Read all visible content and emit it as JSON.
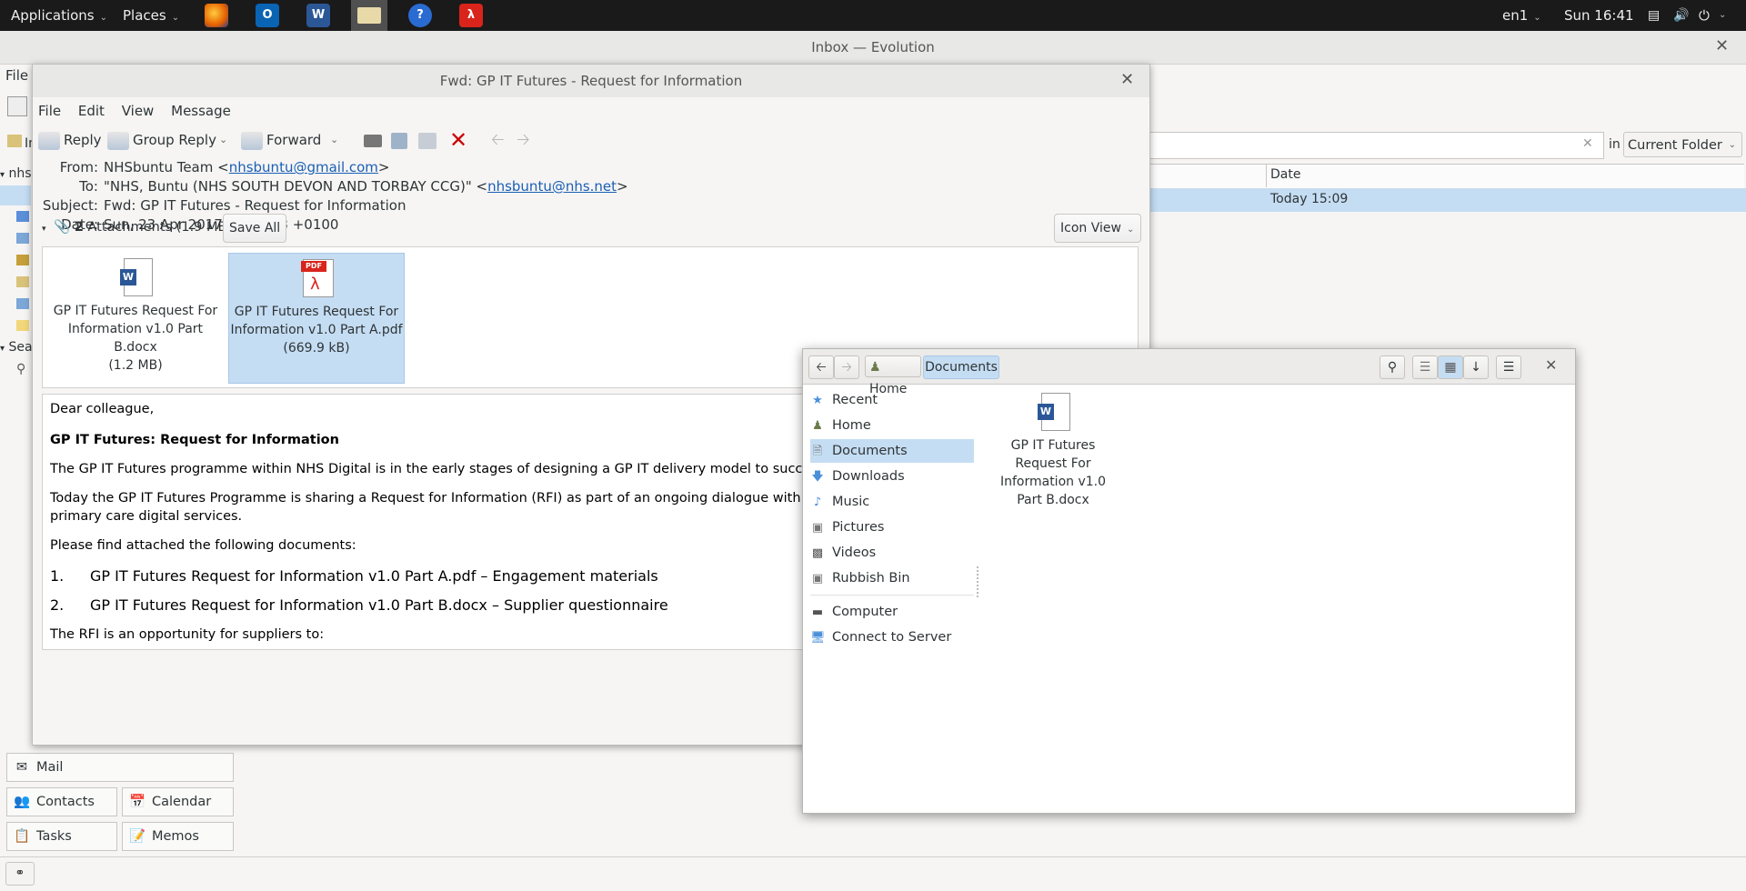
{
  "topbar": {
    "applications": "Applications",
    "places": "Places",
    "language": "en1",
    "clock": "Sun 16:41"
  },
  "evolution": {
    "window_title": "Inbox — Evolution",
    "file_menu": "File",
    "search_scope_label": "in",
    "search_scope_value": "Current Folder",
    "left_tree_account": "nhs",
    "left_tree_search": "Sea",
    "list_header_date": "Date",
    "list_row_date": "Today 15:09",
    "switcher": {
      "mail": "Mail",
      "contacts": "Contacts",
      "calendar": "Calendar",
      "tasks": "Tasks",
      "memos": "Memos"
    }
  },
  "message": {
    "window_title": "Fwd: GP IT Futures - Request for Information",
    "menus": [
      "File",
      "Edit",
      "View",
      "Message"
    ],
    "toolbar": {
      "reply": "Reply",
      "group_reply": "Group Reply",
      "forward": "Forward"
    },
    "headers": {
      "from_label": "From:",
      "from_name": "NHSbuntu Team <",
      "from_email": "nhsbuntu@gmail.com",
      "from_close": ">",
      "to_label": "To:",
      "to_name": "\"NHS, Buntu (NHS SOUTH DEVON AND TORBAY CCG)\" <",
      "to_email": "nhsbuntu@nhs.net",
      "to_close": ">",
      "subject_label": "Subject:",
      "subject": "Fwd: GP IT Futures - Request for Information",
      "date_label": "Date:",
      "date": "Sun, 23 Apr 2017 15:09:13 +0100"
    },
    "attachments_bar": {
      "count": "2",
      "summary": " Attachments (1.9 MB)",
      "save_all": "Save All",
      "view_mode": "Icon View"
    },
    "attachments": [
      {
        "name": "GP IT Futures Request For Information v1.0 Part B.docx",
        "size": "(1.2 MB)",
        "icon": "word-doc-icon"
      },
      {
        "name": "GP IT Futures Request For Information v1.0 Part A.pdf",
        "size": "(669.9 kB)",
        "icon": "pdf-doc-icon"
      }
    ],
    "body": {
      "greeting": "Dear colleague,",
      "heading": "GP IT Futures: Request for Information",
      "p1": "The GP IT Futures programme within NHS Digital is in the early stages of designing a GP IT delivery model to succeed the curr",
      "p2a": "Today the GP IT Futures Programme is sharing a Request for Information (RFI) as part of an ongoing dialogue with existing an",
      "p2b": "primary care digital services.",
      "p3": "Please find attached the following documents:",
      "list": [
        {
          "num": "1.",
          "text": "GP IT Futures Request for Information v1.0 Part A.pdf – Engagement materials"
        },
        {
          "num": "2.",
          "text": "GP IT Futures Request for Information v1.0 Part B.docx – Supplier questionnaire"
        }
      ],
      "p4": "The RFI is an opportunity for suppliers to:"
    }
  },
  "files": {
    "path": {
      "home": "Home",
      "current": "Documents"
    },
    "sidebar": [
      {
        "label": "Recent",
        "icon": "recent-icon",
        "selected": false
      },
      {
        "label": "Home",
        "icon": "home-icon",
        "selected": false
      },
      {
        "label": "Documents",
        "icon": "documents-icon",
        "selected": true
      },
      {
        "label": "Downloads",
        "icon": "downloads-icon",
        "selected": false
      },
      {
        "label": "Music",
        "icon": "music-icon",
        "selected": false
      },
      {
        "label": "Pictures",
        "icon": "pictures-icon",
        "selected": false
      },
      {
        "label": "Videos",
        "icon": "videos-icon",
        "selected": false
      },
      {
        "label": "Rubbish Bin",
        "icon": "trash-icon",
        "selected": false
      },
      {
        "label": "Computer",
        "icon": "computer-icon",
        "selected": false
      },
      {
        "label": "Connect to Server",
        "icon": "server-icon",
        "selected": false
      }
    ],
    "items": [
      {
        "name": "GP IT Futures Request For Information v1.0 Part B.docx",
        "icon": "word-doc-icon"
      }
    ]
  },
  "colors": {
    "selection": "#c5ddf3",
    "link": "#1a5fb4",
    "topbar": "#1a1a1a",
    "delete_red": "#cc0000"
  }
}
